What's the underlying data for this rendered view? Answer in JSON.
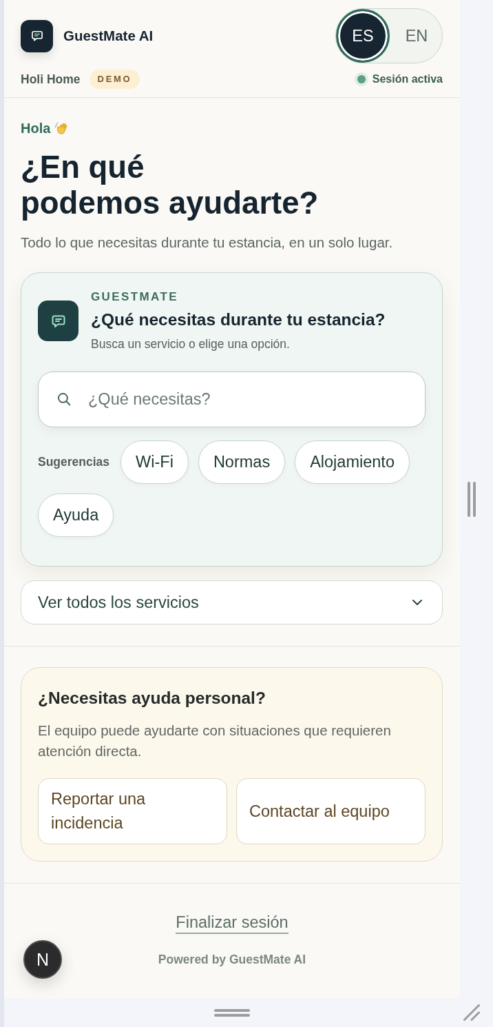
{
  "header": {
    "app_name": "GuestMate AI",
    "languages": [
      {
        "label": "ES",
        "selected": true
      },
      {
        "label": "EN",
        "selected": false
      }
    ],
    "property": "Holi Home",
    "badge": "DEMO",
    "session": {
      "label": "Sesión activa",
      "active": true
    }
  },
  "intro": {
    "greeting": "Hola",
    "heading": "¿En qué\npodemos ayudarte?",
    "subtitle": "Todo lo que necesitas durante tu estancia, en un solo lugar."
  },
  "assistant_card": {
    "eyebrow": "GUESTMATE",
    "title": "¿Qué necesitas durante tu estancia?",
    "subtitle": "Busca un servicio o elige una opción.",
    "search": {
      "placeholder": "¿Qué necesitas?"
    },
    "suggestions_label": "Sugerencias",
    "suggestions": [
      "Wi-Fi",
      "Normas",
      "Alojamiento",
      "Ayuda"
    ]
  },
  "services_dropdown": {
    "label": "Ver todos los servicios",
    "expanded": false
  },
  "help_card": {
    "title": "¿Necesitas ayuda personal?",
    "body": "El equipo puede ayudarte con situaciones que requieren atención directa.",
    "buttons": [
      "Reportar una incidencia",
      "Contactar al equipo"
    ]
  },
  "footer": {
    "logout_link": "Finalizar sesión",
    "powered_by": "Powered by GuestMate AI"
  },
  "dev_indicator": {
    "label": "N"
  }
}
